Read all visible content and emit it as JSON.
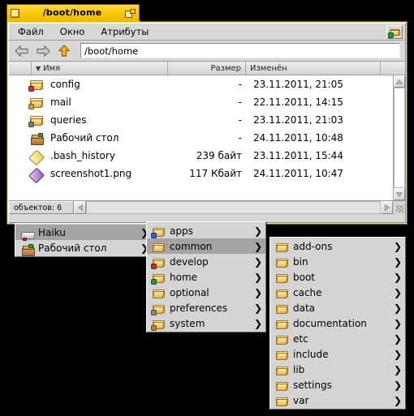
{
  "window": {
    "title": "/boot/home",
    "close_icon": "close-box-icon",
    "zoom_icon": "zoom-box-icon",
    "menubar": {
      "items": [
        {
          "label": "Файл"
        },
        {
          "label": "Окно"
        },
        {
          "label": "Атрибуты"
        }
      ],
      "right_icon": "folder-icon"
    },
    "navbar": {
      "back_icon": "arrow-left-icon",
      "forward_icon": "arrow-right-icon",
      "up_icon": "arrow-up-icon",
      "path_value": "/boot/home",
      "path_placeholder": "/boot/home"
    },
    "columns": [
      {
        "key": "name",
        "label": "Имя",
        "sort_indicator": "▼"
      },
      {
        "key": "size",
        "label": "Размер"
      },
      {
        "key": "modified",
        "label": "Изменён"
      }
    ],
    "files": [
      {
        "icon": "folder-config-icon",
        "name": "config",
        "size": "-",
        "modified": "23.11.2011, 21:05"
      },
      {
        "icon": "folder-mail-icon",
        "name": "mail",
        "size": "-",
        "modified": "22.11.2011, 14:15"
      },
      {
        "icon": "folder-queries-icon",
        "name": "queries",
        "size": "-",
        "modified": "23.11.2011, 21:03"
      },
      {
        "icon": "desktop-folder-icon",
        "name": "Рабочий стол",
        "size": "-",
        "modified": "24.11.2011, 10:48"
      },
      {
        "icon": "text-document-icon",
        "name": ".bash_history",
        "size": "239 байт",
        "modified": "23.11.2011, 15:44"
      },
      {
        "icon": "image-document-icon",
        "name": "screenshot1.png",
        "size": "117 Кбайт",
        "modified": "24.11.2011, 10:47"
      }
    ],
    "status": {
      "label": "объектов: 6"
    },
    "scroll": {
      "v_up_icon": "chevron-up-icon",
      "v_down_icon": "chevron-down-icon",
      "h_left_icon": "chevron-left-icon",
      "h_right_icon": "chevron-right-icon",
      "resize_grip_icon": "resize-grip-icon"
    }
  },
  "menus": {
    "level1": {
      "items": [
        {
          "icon": "disk-icon",
          "label": "Haiku",
          "arrow": "❯",
          "selected": true
        },
        {
          "icon": "desktop-folder-icon",
          "label": "Рабочий стол",
          "arrow": "❯",
          "selected": false
        }
      ]
    },
    "level2": {
      "items": [
        {
          "icon": "folder-apps-icon",
          "label": "apps",
          "arrow": "❯",
          "selected": false
        },
        {
          "icon": "folder-icon",
          "label": "common",
          "arrow": "❯",
          "selected": true
        },
        {
          "icon": "folder-develop-icon",
          "label": "develop",
          "arrow": "❯",
          "selected": false
        },
        {
          "icon": "folder-home-icon",
          "label": "home",
          "arrow": "❯",
          "selected": false
        },
        {
          "icon": "folder-icon",
          "label": "optional",
          "arrow": "❯",
          "selected": false
        },
        {
          "icon": "folder-preferences-icon",
          "label": "preferences",
          "arrow": "❯",
          "selected": false
        },
        {
          "icon": "folder-system-icon",
          "label": "system",
          "arrow": "❯",
          "selected": false
        }
      ]
    },
    "level3": {
      "items": [
        {
          "icon": "folder-icon",
          "label": "add-ons",
          "arrow": "❯",
          "selected": false
        },
        {
          "icon": "folder-icon",
          "label": "bin",
          "arrow": "❯",
          "selected": false
        },
        {
          "icon": "folder-icon",
          "label": "boot",
          "arrow": "❯",
          "selected": false
        },
        {
          "icon": "folder-icon",
          "label": "cache",
          "arrow": "❯",
          "selected": false
        },
        {
          "icon": "folder-icon",
          "label": "data",
          "arrow": "❯",
          "selected": false
        },
        {
          "icon": "folder-icon",
          "label": "documentation",
          "arrow": "❯",
          "selected": false
        },
        {
          "icon": "folder-icon",
          "label": "etc",
          "arrow": "❯",
          "selected": false
        },
        {
          "icon": "folder-icon",
          "label": "include",
          "arrow": "❯",
          "selected": false
        },
        {
          "icon": "folder-icon",
          "label": "lib",
          "arrow": "❯",
          "selected": false
        },
        {
          "icon": "folder-icon",
          "label": "settings",
          "arrow": "❯",
          "selected": false
        },
        {
          "icon": "folder-icon",
          "label": "var",
          "arrow": "❯",
          "selected": false
        }
      ]
    }
  },
  "colors": {
    "title_bar": "#fcc90c",
    "window_bg": "#d8d8d8",
    "menu_bg": "#d4d4d4",
    "menu_selected": "#a4a4a4",
    "desktop": "#000000",
    "list_bg": "#ffffff"
  }
}
